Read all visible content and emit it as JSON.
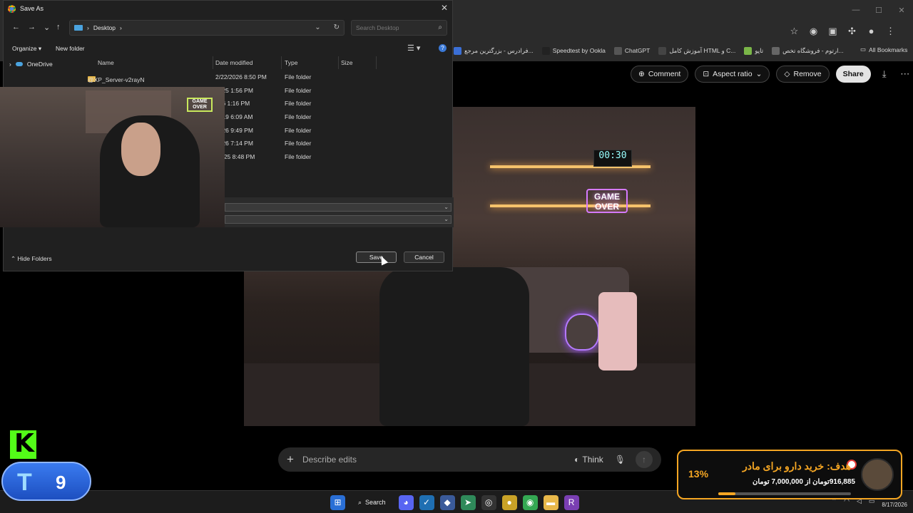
{
  "dialog": {
    "title": "Save As",
    "path": "Desktop",
    "search_placeholder": "Search Desktop",
    "organize": "Organize",
    "new_folder": "New folder",
    "nav_onedrive": "OneDrive",
    "columns": [
      "Name",
      "Date modified",
      "Type",
      "Size"
    ],
    "files": [
      {
        "name": "@XP_Server-v2rayN",
        "date": "2/22/2026 8:50 PM",
        "type": "File folder"
      },
      {
        "name": "",
        "date": "2025 1:56 PM",
        "type": "File folder"
      },
      {
        "name": "",
        "date": "026 1:16 PM",
        "type": "File folder"
      },
      {
        "name": "",
        "date": "2019 6:09 AM",
        "type": "File folder"
      },
      {
        "name": "",
        "date": "2026 9:49 PM",
        "type": "File folder"
      },
      {
        "name": "",
        "date": "2026 7:14 PM",
        "type": "File folder"
      },
      {
        "name": "",
        "date": "/2025 8:48 PM",
        "type": "File folder"
      }
    ],
    "hide_folders": "Hide Folders",
    "save": "Save",
    "cancel": "Cancel"
  },
  "browser": {
    "bookmarks": [
      {
        "label": "فرادرس - بزرگترین مرجع...",
        "color": "#3b6fd6"
      },
      {
        "label": "Speedtest by Ookla",
        "color": "#222"
      },
      {
        "label": "ChatGPT",
        "color": "#555"
      },
      {
        "label": "آموزش کامل HTML و C...",
        "color": "#444"
      },
      {
        "label": "تاپو",
        "color": "#7ab648"
      },
      {
        "label": "ارتوم - فروشگاه تخص...",
        "color": "#666"
      }
    ],
    "all_bookmarks": "All Bookmarks",
    "tools": {
      "comment": "Comment",
      "aspect_ratio": "Aspect ratio",
      "remove": "Remove",
      "share": "Share"
    },
    "image_texts": {
      "sign": "GAME OVER",
      "clock": "00:30"
    },
    "prompt": {
      "placeholder": "Describe edits",
      "think": "Think"
    }
  },
  "webcam": {
    "sign": "GAME OVER"
  },
  "taskbar": {
    "search": "Search",
    "date": "8/17/2026"
  },
  "overlays": {
    "kick_letter": "K",
    "sub_letter": "T",
    "sub_count": "9",
    "goal_percent": "13%",
    "goal_fraction": 0.13,
    "goal_title": "هدف: خرید دارو برای مادر",
    "goal_amount": "916,885تومان از 7,000,000 تومان"
  }
}
